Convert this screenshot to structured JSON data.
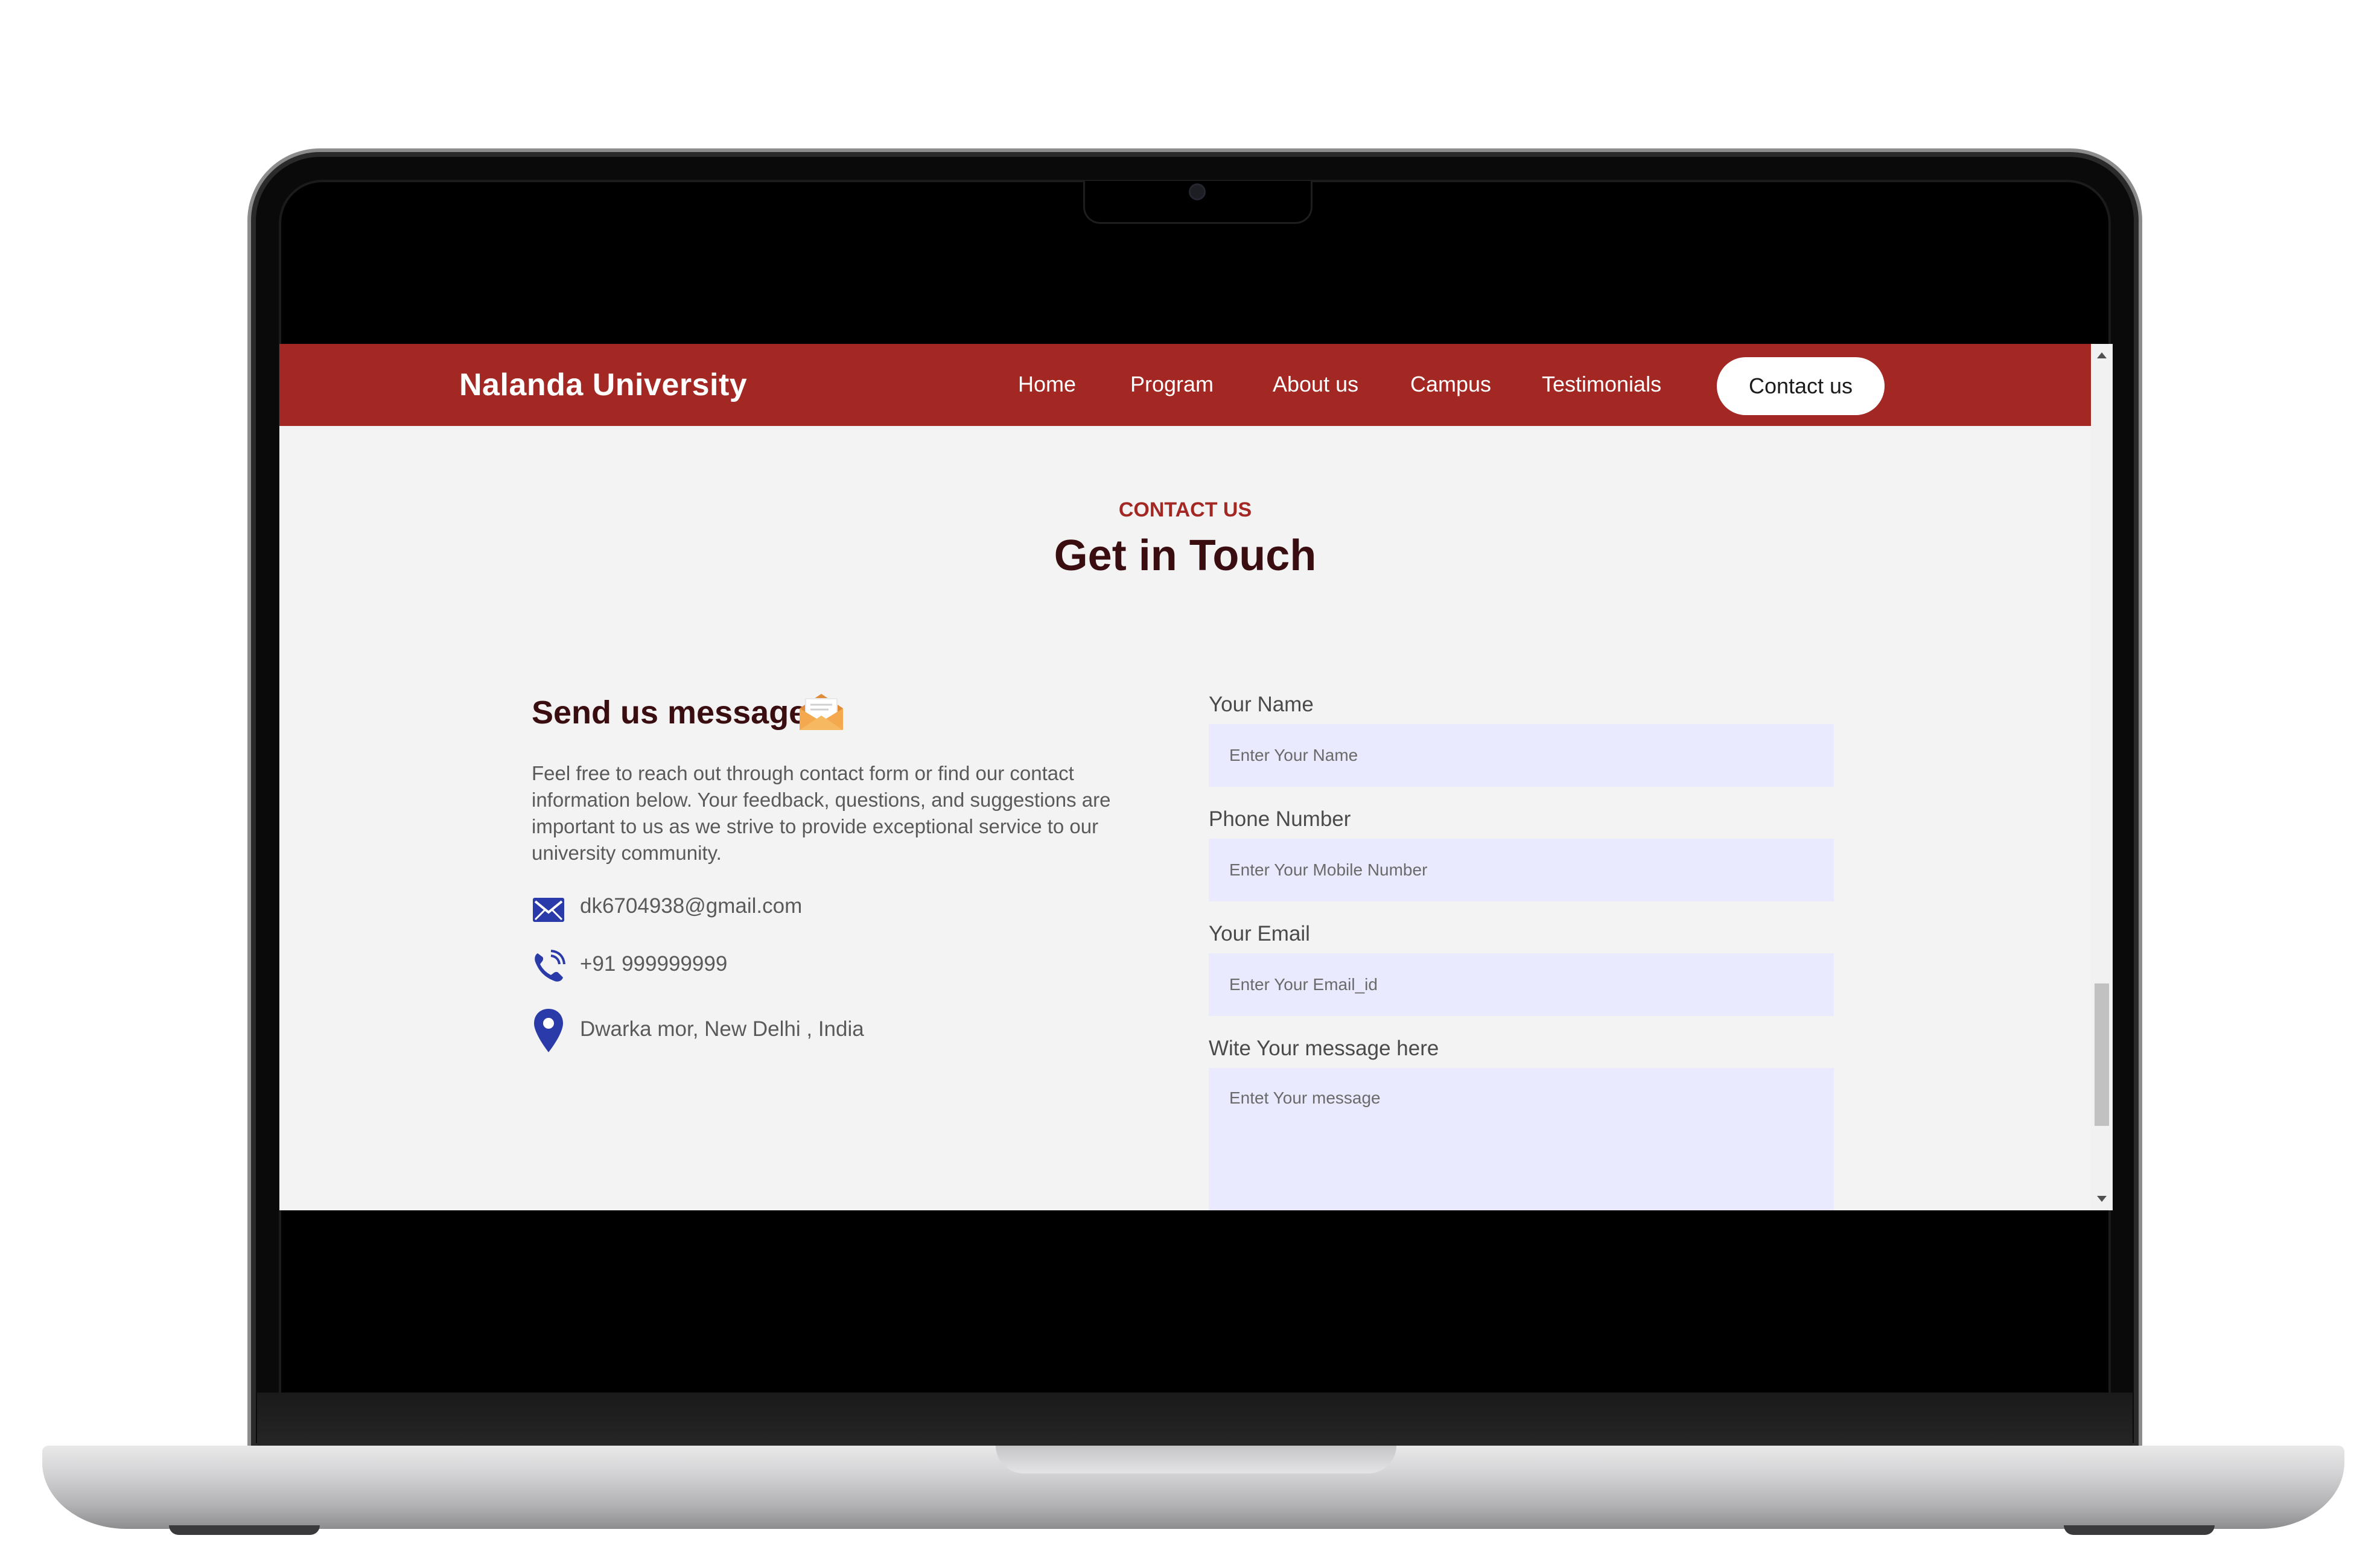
{
  "site": {
    "brand": "Nalanda University"
  },
  "nav": {
    "items": [
      "Home",
      "Program",
      "About us",
      "Campus",
      "Testimonials"
    ],
    "cta": "Contact us"
  },
  "section": {
    "eyebrow": "CONTACT US",
    "title": "Get in Touch"
  },
  "message": {
    "title": "Send us message",
    "description": "Feel free to reach out through contact form or find our contact information below. Your feedback, questions, and suggestions are important to us as we strive to provide exceptional service to our university community.",
    "email": "dk6704938@gmail.com",
    "phone": "+91 999999999",
    "address": "Dwarka mor, New Delhi , India"
  },
  "form": {
    "name_label": "Your Name",
    "name_placeholder": "Enter Your Name",
    "phone_label": "Phone Number",
    "phone_placeholder": "Enter Your Mobile Number",
    "email_label": "Your Email",
    "email_placeholder": "Enter Your Email_id",
    "message_label": "Wite Your message here",
    "message_placeholder": "Entet Your message"
  },
  "colors": {
    "brand_red": "#a32823",
    "title_dark": "#3a0e10",
    "input_bg": "#e9eafe",
    "icon_blue": "#2a3aa8"
  },
  "icons": [
    "envelope-open-icon",
    "mail-icon",
    "phone-icon",
    "location-pin-icon"
  ]
}
